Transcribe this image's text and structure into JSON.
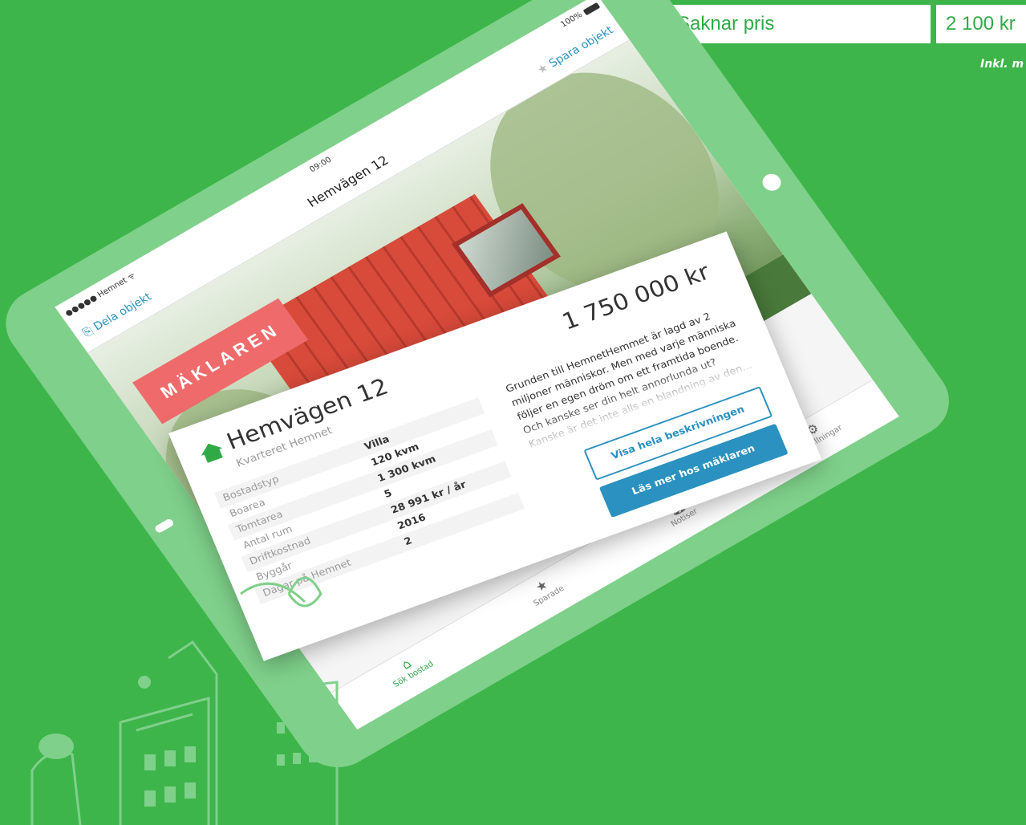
{
  "top_table": {
    "saknar_pris": "Saknar pris",
    "price": "2 100 kr",
    "note": "Inkl. m"
  },
  "statusbar": {
    "carrier": "●●●●● Hemnet ᯤ",
    "time": "09:00",
    "battery": "100%"
  },
  "navbar": {
    "share_label": "Dela objekt",
    "title": "Hemvägen 12",
    "save_label": "Spara objekt"
  },
  "photo": {
    "badge": "MÄKLAREN"
  },
  "listing": {
    "name": "Hemvägen 12",
    "area": "Kvarteret Hemnet",
    "price": "1 750 000 kr",
    "facts": [
      {
        "key": "Bostadstyp",
        "value": "Villa"
      },
      {
        "key": "Boarea",
        "value": "120 kvm"
      },
      {
        "key": "Tomtarea",
        "value": "1 300 kvm"
      },
      {
        "key": "Antal rum",
        "value": "5"
      },
      {
        "key": "Driftkostnad",
        "value": "28 991 kr / år"
      },
      {
        "key": "Byggår",
        "value": "2016"
      },
      {
        "key": "Dagar på Hemnet",
        "value": "2"
      }
    ],
    "description": "Grunden till HemnetHemmet är lagd av 2 miljoner människor. Men med varje människa följer en egen dröm om ett framtida boende. Och kanske ser din helt annorlunda ut? Kanske är det inte alls en blandning av den...",
    "show_description_button": "Visa hela beskrivningen",
    "read_more_button": "Läs mer hos mäklaren"
  },
  "tabbar": {
    "items": [
      {
        "label": "Sök bostad",
        "icon": "home-icon"
      },
      {
        "label": "Sparade",
        "icon": "star-icon"
      },
      {
        "label": "Notiser",
        "icon": "bell-icon"
      },
      {
        "label": "Inställningar",
        "icon": "gear-icon"
      }
    ]
  },
  "colors": {
    "background": "#3db54a",
    "link": "#2a91c0",
    "badge": "#ef6b6b",
    "house": "#d84a3a"
  }
}
